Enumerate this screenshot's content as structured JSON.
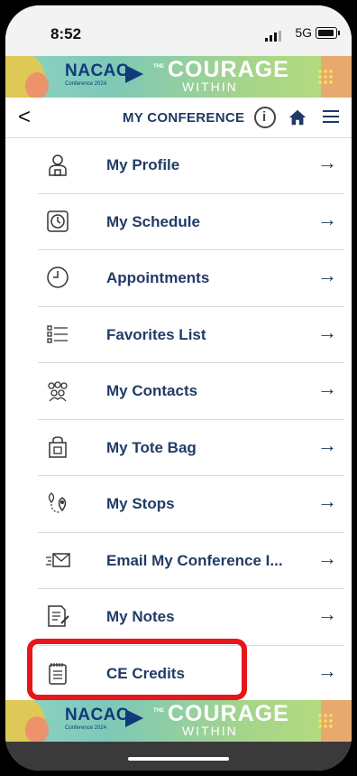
{
  "status": {
    "time": "8:52",
    "network": "5G"
  },
  "banner": {
    "org": "NACAC",
    "sub": "Conference 2024",
    "the": "THE",
    "main": "COURAGE",
    "tag": "WITHIN"
  },
  "nav": {
    "title": "MY CONFERENCE"
  },
  "items": [
    {
      "label": "My Profile",
      "icon": "profile-icon"
    },
    {
      "label": "My Schedule",
      "icon": "clock-icon"
    },
    {
      "label": "Appointments",
      "icon": "appointment-clock-icon"
    },
    {
      "label": "Favorites List",
      "icon": "list-icon"
    },
    {
      "label": "My Contacts",
      "icon": "contacts-icon"
    },
    {
      "label": "My Tote Bag",
      "icon": "tote-bag-icon"
    },
    {
      "label": "My Stops",
      "icon": "location-pins-icon"
    },
    {
      "label": "Email My Conference I...",
      "icon": "envelope-icon"
    },
    {
      "label": "My Notes",
      "icon": "notes-icon"
    },
    {
      "label": "CE Credits",
      "icon": "notepad-icon"
    }
  ],
  "arrow": "→",
  "back": "<",
  "colors": {
    "text": "#213b66",
    "highlight": "#e8151b"
  }
}
